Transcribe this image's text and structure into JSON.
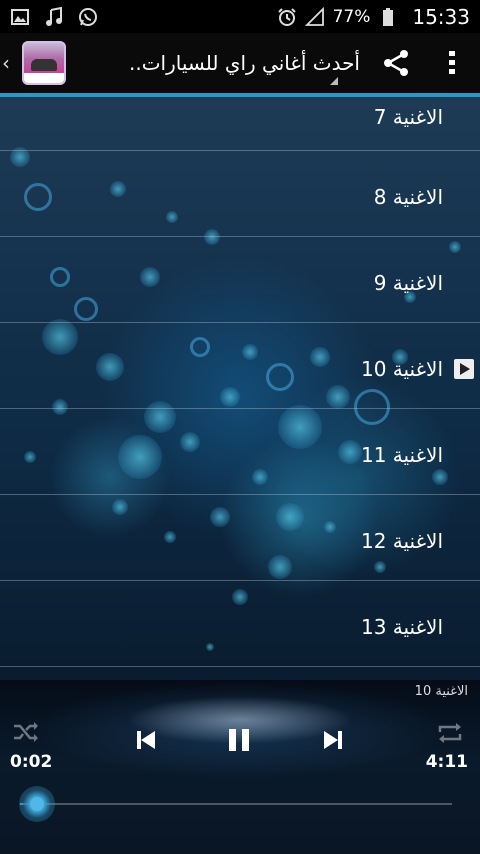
{
  "statusbar": {
    "left_icons": [
      "gallery-icon",
      "music-note-icon",
      "whatsapp-icon"
    ],
    "right_icons": [
      "alarm-icon",
      "signal-icon",
      "battery-icon"
    ],
    "battery_percent": "77%",
    "time": "15:33"
  },
  "actionbar": {
    "title": "أحدث أغاني راي للسيارات..",
    "share_icon": "share-icon",
    "menu_icon": "overflow-menu-icon"
  },
  "songs": [
    {
      "label": "الاغنية 7",
      "playing": false
    },
    {
      "label": "الاغنية 8",
      "playing": false
    },
    {
      "label": "الاغنية 9",
      "playing": false
    },
    {
      "label": "الاغنية 10",
      "playing": true
    },
    {
      "label": "الاغنية 11",
      "playing": false
    },
    {
      "label": "الاغنية 12",
      "playing": false
    },
    {
      "label": "الاغنية 13",
      "playing": false
    }
  ],
  "player": {
    "now_playing": "الاغنية 10",
    "current_time": "0:02",
    "total_time": "4:11",
    "progress": 0.008,
    "icons": [
      "shuffle-icon",
      "previous-icon",
      "pause-icon",
      "next-icon",
      "repeat-icon"
    ]
  },
  "colors": {
    "accent": "#2a97c9"
  }
}
